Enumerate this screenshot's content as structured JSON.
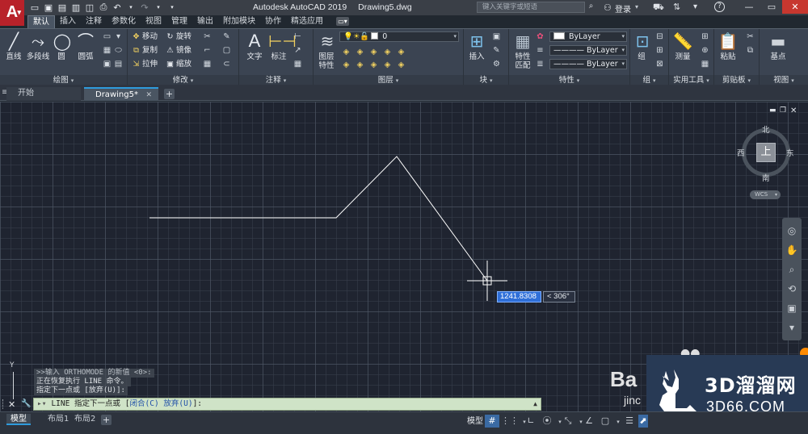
{
  "titlebar": {
    "app_name": "Autodesk AutoCAD 2019",
    "file_name": "Drawing5.dwg",
    "search_placeholder": "键入关键字或短语",
    "login_label": "登录"
  },
  "ribbon_tabs": [
    "默认",
    "插入",
    "注释",
    "参数化",
    "视图",
    "管理",
    "输出",
    "附加模块",
    "协作",
    "精选应用"
  ],
  "panels": {
    "draw": {
      "title": "绘图",
      "line": "直线",
      "polyline": "多段线",
      "circle": "圆",
      "arc": "圆弧"
    },
    "modify": {
      "title": "修改",
      "move": "移动",
      "rotate": "旋转",
      "copy": "复制",
      "mirror": "镜像",
      "stretch": "拉伸",
      "scale": "缩放"
    },
    "annotation": {
      "title": "注释",
      "text": "文字",
      "dimension": "标注"
    },
    "layers": {
      "title": "图层",
      "layer_properties_1": "图层",
      "layer_properties_2": "特性",
      "current_layer": "0"
    },
    "block": {
      "title": "块",
      "insert": "插入"
    },
    "properties": {
      "title": "特性",
      "match_1": "特性",
      "match_2": "匹配",
      "color": "ByLayer",
      "linetype": "ByLayer",
      "lineweight": "ByLayer"
    },
    "groups": {
      "title": "组",
      "group": "组"
    },
    "utilities": {
      "title": "实用工具",
      "measure": "测量"
    },
    "clipboard": {
      "title": "剪贴板",
      "paste": "粘贴"
    },
    "view": {
      "title": "视图",
      "base": "基点"
    }
  },
  "doc_tabs": {
    "start": "开始",
    "drawing": "Drawing5*"
  },
  "viewcube": {
    "north": "北",
    "south": "南",
    "west": "西",
    "east": "东",
    "face": "上",
    "wcs": "WCS"
  },
  "ucs_y_label": "Y",
  "dynamic_input": {
    "length": "1241.8308",
    "angle": "< 306°"
  },
  "command_history": [
    ">>输入 ORTHOMODE 的新值 <0>:",
    "正在恢复执行 LINE 命令。",
    "指定下一点或 [放弃(U)]:"
  ],
  "command_line": {
    "prompt_prefix": "LINE 指定下一点或 [",
    "option_close": "闭合(C)",
    "option_undo": "放弃(U)",
    "prompt_suffix": "]:"
  },
  "layout_tabs": [
    "模型",
    "布局1",
    "布局2"
  ],
  "statusbar": {
    "model_label": "模型"
  },
  "watermark": {
    "title": "3D溜溜网",
    "url": "3D66.COM",
    "baidu_1": "Ba",
    "baidu_2": "jinc"
  },
  "geometry": {
    "line_color": "#ffffff",
    "accent_blue": "#2f6fd8",
    "logo_red": "#b8222a"
  }
}
